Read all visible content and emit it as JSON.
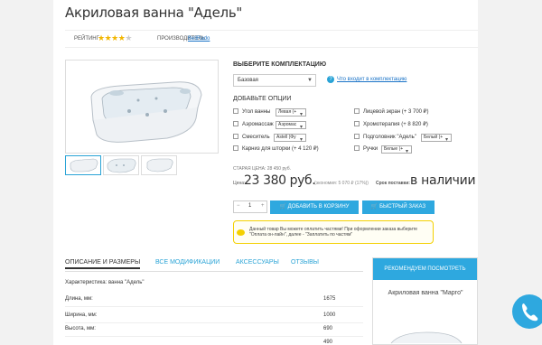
{
  "product": {
    "title": "Акриловая ванна \"Адель\"",
    "rating_label": "РЕЙТИНГ",
    "rating_stars": 4,
    "rating_max": 5,
    "maker_label": "ПРОИЗВОДИТЕЛЬ:",
    "maker_name": "BellRado"
  },
  "config": {
    "heading": "ВЫБЕРИТЕ КОМПЛЕКТАЦИЮ",
    "selected": "Базовая",
    "help_icon": "question-icon",
    "help_link": "Что входит в комплектацию"
  },
  "options": {
    "heading": "ДОБАВЬТЕ ОПЦИИ",
    "left": [
      {
        "label": "Угол ванны",
        "select": "Левая (+"
      },
      {
        "label": "Аэромассаж",
        "select": "Аэромас"
      },
      {
        "label": "Смеситель",
        "select": "Astell (Фу"
      },
      {
        "label": "Карниз для шторки (+ 4 120 ₽)",
        "select": ""
      }
    ],
    "right": [
      {
        "label": "Лицевой экран (+ 3 700 ₽)",
        "select": ""
      },
      {
        "label": "Хромотерапия (+ 8 820 ₽)",
        "select": ""
      },
      {
        "label": "Подголовник \"Адель\"",
        "select": "Белый (+"
      },
      {
        "label": "Ручки",
        "select": "Белые (+"
      }
    ]
  },
  "pricing": {
    "old_price": "СТАРАЯ ЦЕНА: 28 450 руб.",
    "price_label": "Цена:",
    "price": "23 380 руб.",
    "economy": "(экономия: 5 070 ₽ (17%))",
    "delivery_label": "Срок поставки:",
    "stock": "в наличии"
  },
  "cart": {
    "qty": "1",
    "minus": "−",
    "plus": "+",
    "add_label": "ДОБАВИТЬ В КОРЗИНУ",
    "quick_label": "БЫСТРЫЙ ЗАКАЗ",
    "cart_icon": "cart-icon",
    "quick_icon": "cart-icon"
  },
  "notice": {
    "text": "Данный товар Вы можете оплатить частями! При оформлении заказа выберите \"Оплата он-лайн\", далее - \"Заплатить по частям\""
  },
  "tabs": [
    {
      "label": "ОПИСАНИЕ И РАЗМЕРЫ",
      "active": true
    },
    {
      "label": "ВСЕ МОДИФИКАЦИИ",
      "active": false
    },
    {
      "label": "АКСЕССУАРЫ",
      "active": false
    },
    {
      "label": "ОТЗЫВЫ",
      "active": false
    }
  ],
  "specs": {
    "title": "Характеристика: ванна \"Адель\"",
    "rows": [
      {
        "k": "Длина, мм:",
        "v": "1675"
      },
      {
        "k": "Ширина, мм:",
        "v": "1000"
      },
      {
        "k": "Высота, мм:",
        "v": "690"
      },
      {
        "k": "",
        "v": "490"
      }
    ]
  },
  "recommend": {
    "header": "РЕКОМЕНДУЕМ ПОСМОТРЕТЬ",
    "name": "Акриловая ванна \"Марго\""
  },
  "colors": {
    "accent": "#2ea8df",
    "link": "#1a73c7",
    "star": "#f2b600",
    "notice_border": "#f4d000"
  }
}
